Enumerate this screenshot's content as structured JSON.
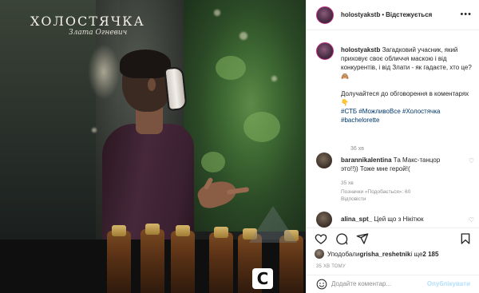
{
  "media": {
    "show_logo": "ХОЛОСТЯЧКА",
    "show_logo_sub": "Злата Огневич",
    "channel_badge": "С"
  },
  "header": {
    "username": "holostyakstb",
    "separator": "•",
    "follow_label": "Відстежується",
    "more_icon": "more-horizontal-icon"
  },
  "caption": {
    "username": "holostyakstb",
    "text": " Загадковий учасник, який приховує своє обличчя маскою і від конкурентів, і від Злати - як гадаєте, хто це? 🙈",
    "text2": "Долучайтеся до обговорення в коментарях👇",
    "hashtags": "#СТБ #МожливоВсе #Холостячка #bachelorette",
    "time": "36 хв"
  },
  "comments": [
    {
      "username": "barannikalentina",
      "text": " Та Макс-танцор это!!)) Тоже мне герой!(",
      "time": "35 хв",
      "likes": "Позначки «Подобається»: 60",
      "reply": "Відповісти"
    },
    {
      "username": "alina_spt_",
      "text": " Цей що з Нікітюк"
    }
  ],
  "actions": {
    "like_icon": "heart-icon",
    "comment_icon": "comment-icon",
    "share_icon": "share-icon",
    "save_icon": "bookmark-icon"
  },
  "likes_line": {
    "prefix": "Уподобали ",
    "user": "grisha_reshetnik",
    "middle": " і ще ",
    "count": "2 185"
  },
  "post_time": "35 ХВ ТОМУ",
  "add_comment": {
    "placeholder": "Додайте коментар...",
    "publish_label": "Опублікувати"
  },
  "colors": {
    "accent_link": "#00376b",
    "publish_disabled": "#b2dffc",
    "muted": "#8e8e8e"
  }
}
